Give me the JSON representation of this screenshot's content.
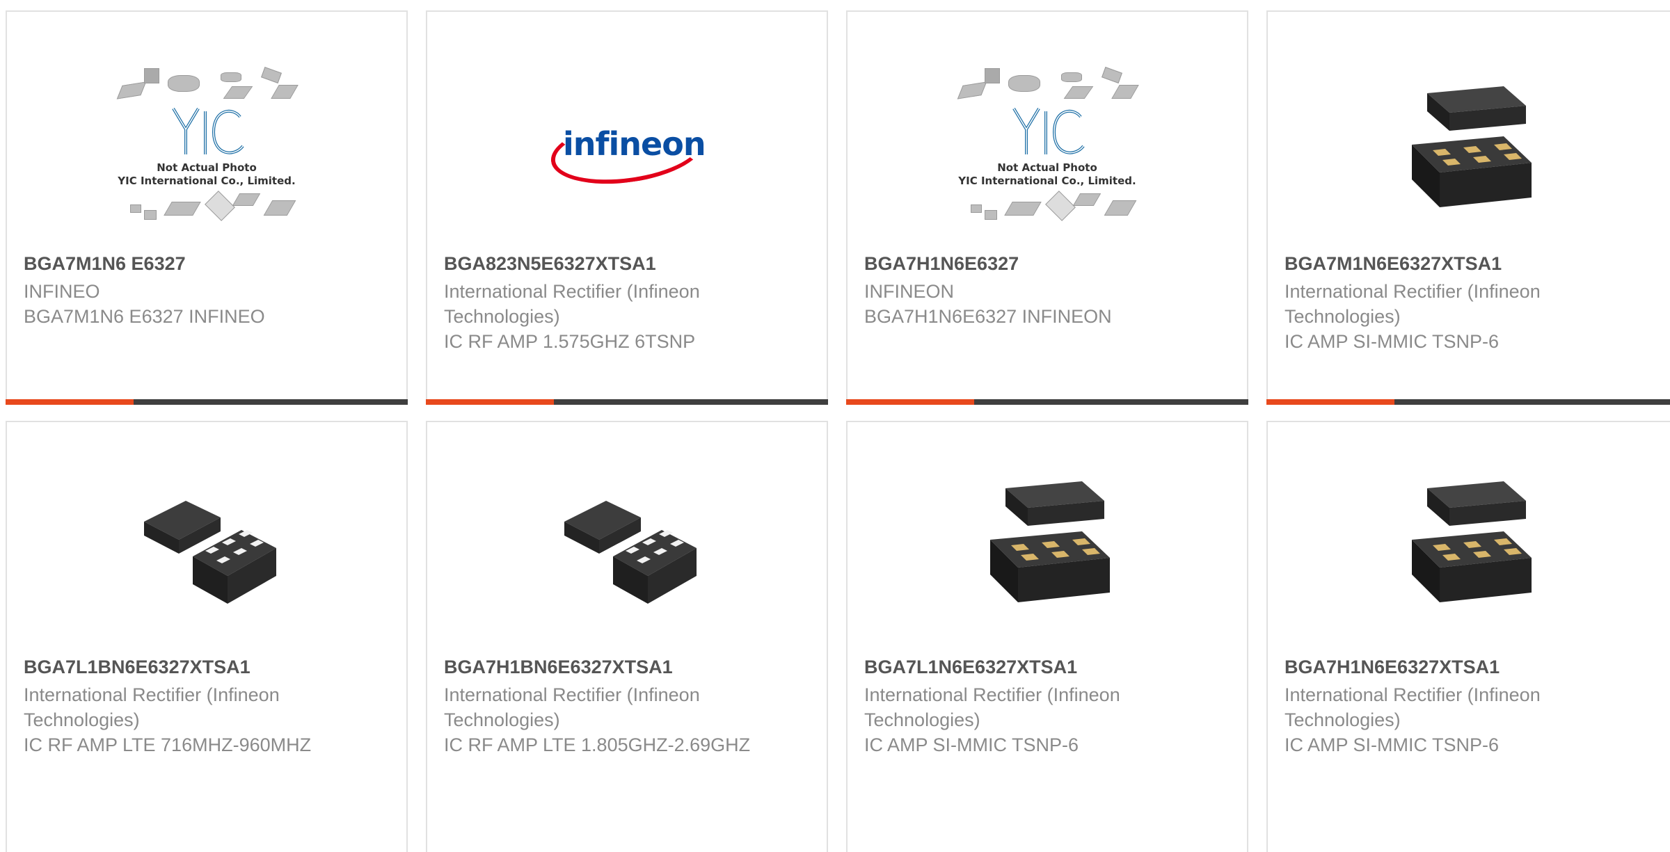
{
  "products": [
    {
      "part": "BGA7M1N6 E6327",
      "manufacturer": "INFINEO",
      "description": "BGA7M1N6 E6327 INFINEO",
      "image": "yic-placeholder-icon"
    },
    {
      "part": "BGA823N5E6327XTSA1",
      "manufacturer": "International Rectifier (Infineon Technologies)",
      "description": "IC RF AMP 1.575GHZ 6TSNP",
      "image": "infineon-logo"
    },
    {
      "part": "BGA7H1N6E6327",
      "manufacturer": "INFINEON",
      "description": "BGA7H1N6E6327 INFINEON",
      "image": "yic-placeholder-icon"
    },
    {
      "part": "BGA7M1N6E6327XTSA1",
      "manufacturer": "International Rectifier (Infineon Technologies)",
      "description": "IC AMP SI-MMIC TSNP-6",
      "image": "chip-package-icon"
    },
    {
      "part": "BGA7L1BN6E6327XTSA1",
      "manufacturer": "International Rectifier (Infineon Technologies)",
      "description": "IC RF AMP LTE 716MHZ-960MHZ",
      "image": "chip-package-angled-icon"
    },
    {
      "part": "BGA7H1BN6E6327XTSA1",
      "manufacturer": "International Rectifier (Infineon Technologies)",
      "description": "IC RF AMP LTE 1.805GHZ-2.69GHZ",
      "image": "chip-package-angled-icon"
    },
    {
      "part": "BGA7L1N6E6327XTSA1",
      "manufacturer": "International Rectifier (Infineon Technologies)",
      "description": "IC AMP SI-MMIC TSNP-6",
      "image": "chip-package-icon"
    },
    {
      "part": "BGA7H1N6E6327XTSA1",
      "manufacturer": "International Rectifier (Infineon Technologies)",
      "description": "IC AMP SI-MMIC TSNP-6",
      "image": "chip-package-icon"
    }
  ],
  "placeholder": {
    "logo_text": "YIC",
    "line1": "Not Actual Photo",
    "line2": "YIC International Co., Limited."
  },
  "infineon_logo_text": "infineon",
  "colors": {
    "accent": "#e8491d",
    "bar": "#3f3f3f",
    "border": "#e1e1e1",
    "title": "#555555",
    "text": "#8a8a8a"
  }
}
